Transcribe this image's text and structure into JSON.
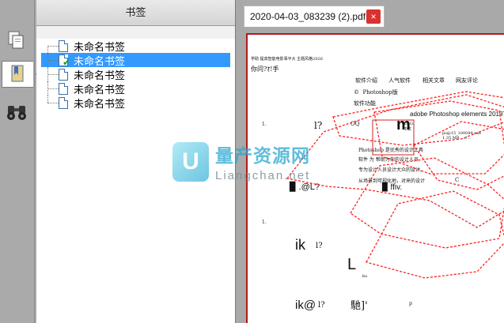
{
  "toolbar": {
    "tools": [
      {
        "name": "pages-tool",
        "icon": "pages-icon"
      },
      {
        "name": "bookmarks-tool",
        "icon": "bookmark-icon",
        "active": true
      },
      {
        "name": "search-tool",
        "icon": "binoculars-icon"
      }
    ]
  },
  "bookmarks": {
    "header": "书签",
    "items": [
      {
        "label": "未命名书签",
        "selected": false
      },
      {
        "label": "未命名书签",
        "selected": true
      },
      {
        "label": "未命名书签",
        "selected": false
      },
      {
        "label": "未命名书签",
        "selected": false
      },
      {
        "label": "未命名书签",
        "selected": false
      }
    ]
  },
  "document": {
    "tab_title": "2020-04-03_083239 (2).pdf",
    "close_label": "×",
    "page": {
      "top_small": "学助  提高智能电影事平大  主题风格2026",
      "hand_text": "你问?ｵ!手",
      "nav": [
        "软件介绍",
        "人气软件",
        "相关文章",
        "网友评论"
      ],
      "photoshop": "Photoshop版",
      "software_fn": "软件功能",
      "adobe": "adobe Photoshop elements 2019TS",
      "m_char": "m",
      "small_info": "23 G\n中文",
      "file_info": "ps@15_100084.exe\n1.35 MB  .../...",
      "q_mark": "l?",
      "oq": "OQ",
      "ps_title": "Photoshop 是优秀的设计工具",
      "line_a": "软件 为 帮助为你的设计人员",
      "line_b": "专为设计人员设计大众的设计。",
      "line_c": "从场景到可视化地，对来的设计",
      "l_mark": "▉ .@L?",
      "ffiv": "▉ ffiv.",
      "c_mark": "C",
      "ik1": "ik",
      "ik1b": "l?",
      "big_l": "L",
      "small_u": "ku",
      "ik2": "ik@",
      "ik2b": "l?",
      "hu": "馳]'",
      "p": "p",
      "num": "1.",
      "num2": "1."
    }
  },
  "watermark": {
    "logo": "U",
    "cn": "量产资源网",
    "en": "Liangchan.net"
  },
  "colors": {
    "selection": "#3399ff",
    "close_button": "#d9322f",
    "page_border": "#b01a1a",
    "annotation": "#ff0000"
  }
}
